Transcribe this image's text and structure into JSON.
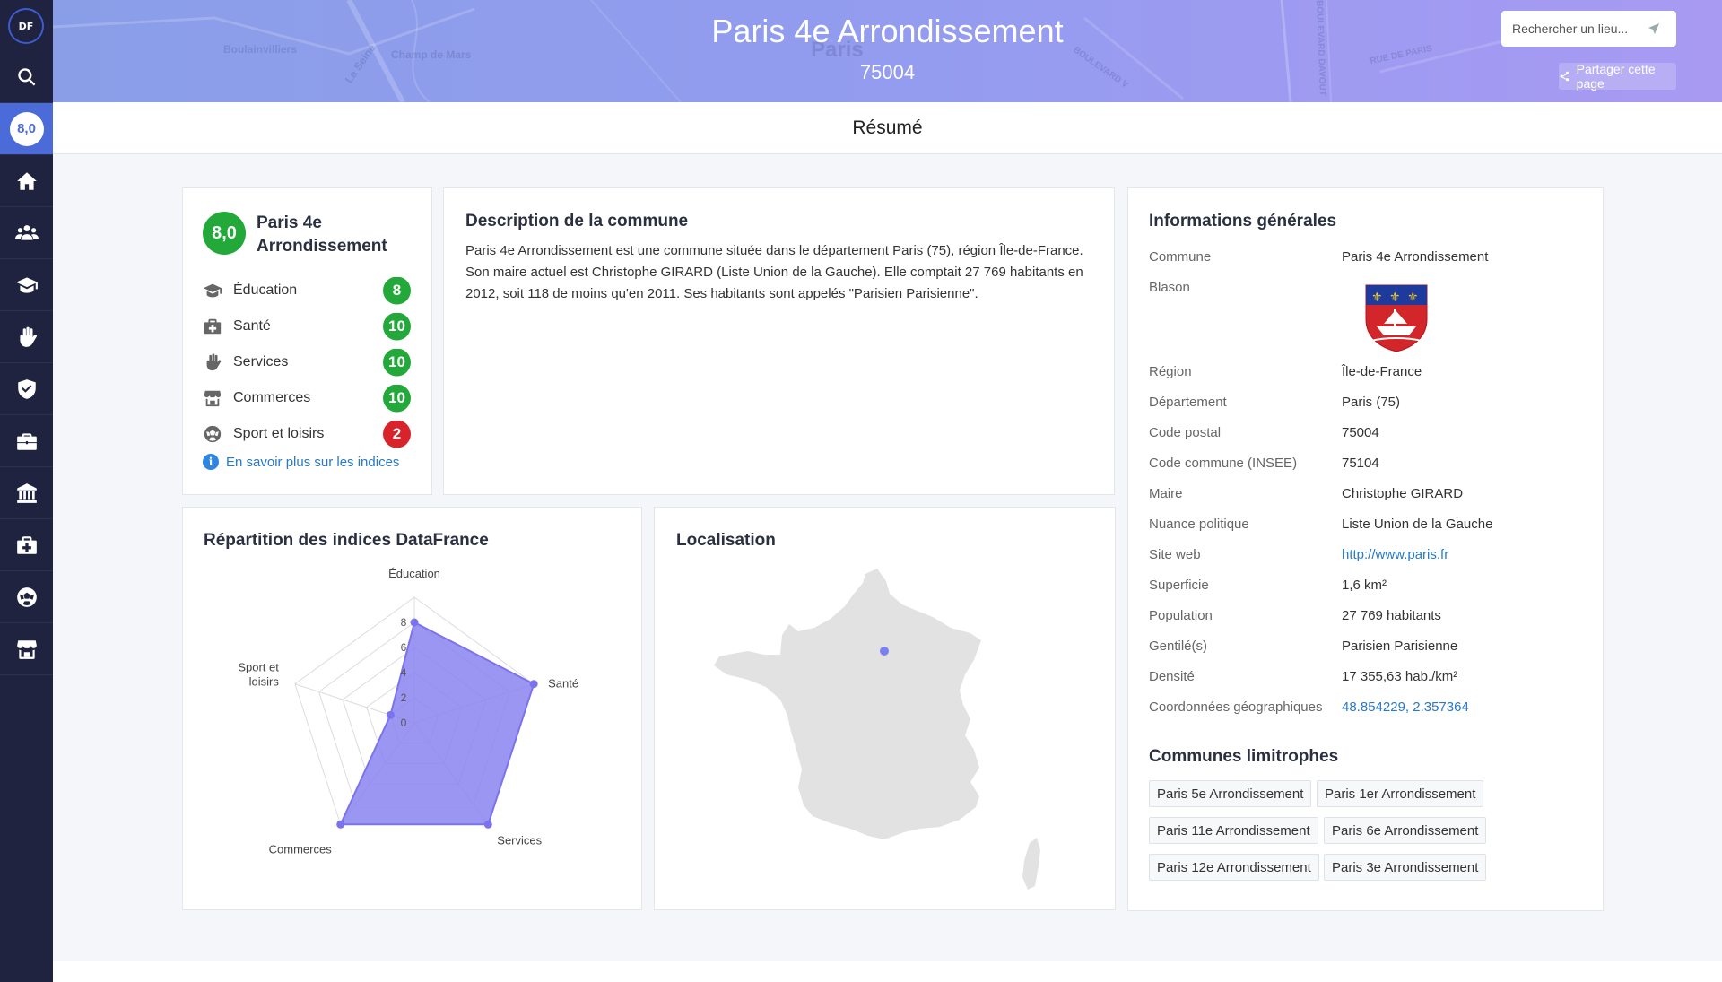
{
  "app": {
    "logo_text": "DF",
    "score_badge": "8,0"
  },
  "sidebar": {
    "items": [
      {
        "icon": "search-icon"
      },
      {
        "icon": "score-badge",
        "active": true
      },
      {
        "icon": "home-icon"
      },
      {
        "icon": "people-icon"
      },
      {
        "icon": "graduation-cap-icon"
      },
      {
        "icon": "hand-icon"
      },
      {
        "icon": "shield-check-icon"
      },
      {
        "icon": "briefcase-icon"
      },
      {
        "icon": "institution-icon"
      },
      {
        "icon": "medical-kit-icon"
      },
      {
        "icon": "soccer-ball-icon"
      },
      {
        "icon": "store-icon"
      }
    ]
  },
  "header": {
    "title": "Paris 4e Arrondissement",
    "postcode": "75004",
    "search_placeholder": "Rechercher un lieu...",
    "share_label": "Partager cette page",
    "map_labels": [
      "Boulainvilliers",
      "La Seine",
      "Champ de Mars",
      "Paris",
      "BOULEVARD V",
      "BOULEVARD DAVOUT",
      "RUE DE PARIS"
    ]
  },
  "summary": {
    "title": "Résumé"
  },
  "scores": {
    "overall": "8,0",
    "commune_name": "Paris 4e Arrondissement",
    "indices": [
      {
        "label": "Éducation",
        "value": "8",
        "color": "#22a93a",
        "icon": "graduation-cap-icon"
      },
      {
        "label": "Santé",
        "value": "10",
        "color": "#22a93a",
        "icon": "medical-kit-icon"
      },
      {
        "label": "Services",
        "value": "10",
        "color": "#22a93a",
        "icon": "hand-icon"
      },
      {
        "label": "Commerces",
        "value": "10",
        "color": "#22a93a",
        "icon": "store-icon"
      },
      {
        "label": "Sport et loisirs",
        "value": "2",
        "color": "#d9232a",
        "icon": "soccer-ball-icon"
      }
    ],
    "more_link": "En savoir plus sur les indices"
  },
  "description": {
    "title": "Description de la commune",
    "text": "Paris 4e Arrondissement est une commune située dans le département Paris (75), région Île-de-France. Son maire actuel est Christophe GIRARD (Liste Union de la Gauche). Elle comptait 27 769 habitants en 2012, soit 118 de moins qu'en 2011. Ses habitants sont appelés \"Parisien Parisienne\"."
  },
  "general_info": {
    "title": "Informations générales",
    "rows": [
      {
        "key": "Commune",
        "value": "Paris 4e Arrondissement"
      },
      {
        "key": "Blason",
        "value": ""
      },
      {
        "key": "Région",
        "value": "Île-de-France"
      },
      {
        "key": "Département",
        "value": "Paris (75)"
      },
      {
        "key": "Code postal",
        "value": "75004"
      },
      {
        "key": "Code commune (INSEE)",
        "value": "75104"
      },
      {
        "key": "Maire",
        "value": "Christophe GIRARD"
      },
      {
        "key": "Nuance politique",
        "value": "Liste Union de la Gauche"
      },
      {
        "key": "Site web",
        "value": "http://www.paris.fr",
        "link": true
      },
      {
        "key": "Superficie",
        "value": "1,6 km²"
      },
      {
        "key": "Population",
        "value": "27 769 habitants"
      },
      {
        "key": "Gentilé(s)",
        "value": "Parisien Parisienne"
      },
      {
        "key": "Densité",
        "value": "17 355,63 hab./km²"
      },
      {
        "key": "Coordonnées géographiques",
        "value": "48.854229, 2.357364",
        "link": true
      }
    ]
  },
  "neighbours": {
    "title": "Communes limitrophes",
    "items": [
      "Paris 5e Arrondissement",
      "Paris 1er Arrondissement",
      "Paris 11e Arrondissement",
      "Paris 6e Arrondissement",
      "Paris 12e Arrondissement",
      "Paris 3e Arrondissement"
    ]
  },
  "radar": {
    "title": "Répartition des indices DataFrance"
  },
  "location": {
    "title": "Localisation",
    "accent": "#7b7ff0"
  },
  "chart_data": {
    "type": "radar",
    "title": "Répartition des indices DataFrance",
    "categories": [
      "Éducation",
      "Santé",
      "Services",
      "Commerces",
      "Sport et loisirs"
    ],
    "values": [
      8,
      10,
      10,
      10,
      2
    ],
    "rmax": 10,
    "ticks": [
      "0",
      "2",
      "4",
      "6",
      "8"
    ],
    "fill_color": "#8a84f0",
    "stroke_color": "#7b73ec"
  }
}
